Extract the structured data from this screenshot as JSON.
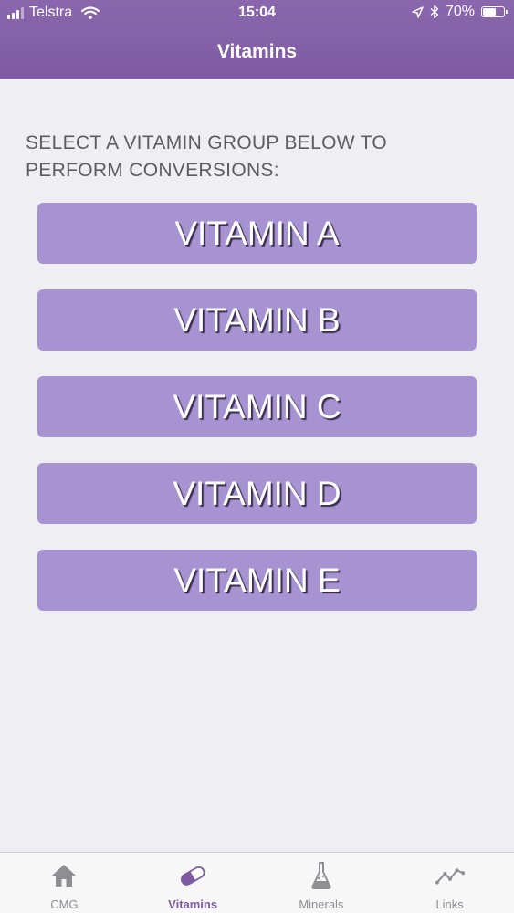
{
  "status_bar": {
    "carrier": "Telstra",
    "time": "15:04",
    "battery": "70%",
    "battery_level": 0.7,
    "icons": [
      "signal-icon",
      "wifi-icon",
      "location-arrow-icon",
      "bluetooth-icon",
      "battery-icon"
    ]
  },
  "nav": {
    "title": "Vitamins"
  },
  "content": {
    "instruction": "SELECT A VITAMIN GROUP BELOW TO PERFORM CONVERSIONS:",
    "buttons": [
      {
        "label": "VITAMIN A"
      },
      {
        "label": "VITAMIN B"
      },
      {
        "label": "VITAMIN C"
      },
      {
        "label": "VITAMIN D"
      },
      {
        "label": "VITAMIN E"
      }
    ]
  },
  "tab_bar": {
    "tabs": [
      {
        "label": "CMG",
        "icon": "home-icon",
        "active": false
      },
      {
        "label": "Vitamins",
        "icon": "pill-icon",
        "active": true
      },
      {
        "label": "Minerals",
        "icon": "flask-icon",
        "active": false
      },
      {
        "label": "Links",
        "icon": "chart-line-icon",
        "active": false
      }
    ]
  },
  "colors": {
    "header": "#8a67ad",
    "button": "#a893d2",
    "active_tab": "#7f5aa3",
    "inactive_tab": "#8e8e93",
    "background": "#efeef3"
  }
}
